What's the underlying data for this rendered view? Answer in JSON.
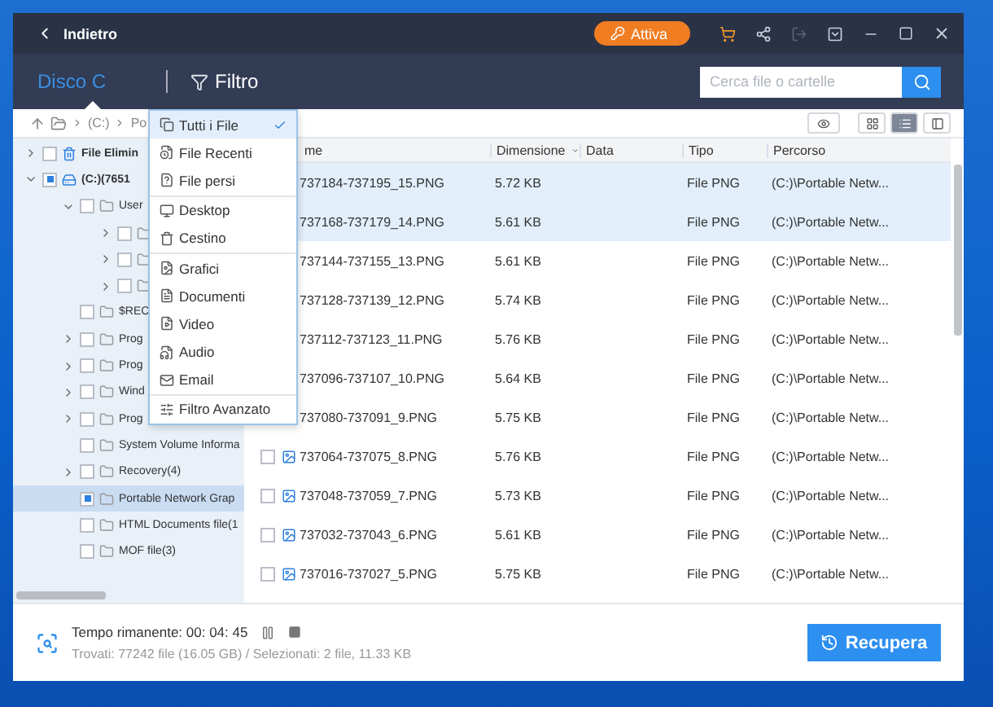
{
  "title_bar": {
    "back": "Indietro",
    "activate": "Attiva"
  },
  "header": {
    "tab": "Disco C",
    "filter": "Filtro",
    "search": {
      "placeholder": "Cerca file o cartelle"
    }
  },
  "breadcrumb": [
    "(C:)",
    "Po"
  ],
  "view_modes": [
    {
      "selected": false
    },
    {
      "selected": true
    },
    {
      "selected": false
    }
  ],
  "tree": [
    {
      "label": "File Elimin",
      "kind": "bin",
      "expandable": true,
      "expanded": false,
      "checked": false,
      "selected": false
    },
    {
      "label": "(C:)(7651",
      "kind": "drive",
      "expandable": true,
      "expanded": true,
      "checked": true,
      "selected": false,
      "children": [
        {
          "label": "User",
          "kind": "folder",
          "expandable": true,
          "expanded": true,
          "checked": false,
          "selected": false,
          "children": [
            {
              "kind": "folder",
              "expandable": true,
              "expanded": false,
              "checked": false,
              "selected": false
            },
            {
              "kind": "folder",
              "expandable": true,
              "expanded": false,
              "checked": false,
              "selected": false
            },
            {
              "kind": "folder",
              "expandable": true,
              "expanded": false,
              "checked": false,
              "selected": false
            }
          ]
        },
        {
          "label": "$REC",
          "kind": "folder",
          "expandable": false,
          "checked": false,
          "selected": false
        },
        {
          "label": "Prog",
          "kind": "folder",
          "expandable": true,
          "expanded": false,
          "checked": false,
          "selected": false
        },
        {
          "label": "Prog",
          "kind": "folder",
          "expandable": true,
          "expanded": false,
          "checked": false,
          "selected": false
        },
        {
          "label": "Wind",
          "kind": "folder",
          "expandable": true,
          "expanded": false,
          "checked": false,
          "selected": false
        },
        {
          "label": "Prog",
          "kind": "folder",
          "expandable": true,
          "expanded": false,
          "checked": false,
          "selected": false
        },
        {
          "label": "System Volume Informa",
          "kind": "folder",
          "expandable": false,
          "checked": false,
          "selected": false
        },
        {
          "label": "Recovery(4)",
          "kind": "folder",
          "expandable": true,
          "expanded": false,
          "checked": false,
          "selected": false
        },
        {
          "label": "Portable Network Grap",
          "kind": "folder",
          "expandable": false,
          "checked": true,
          "selected": true
        },
        {
          "label": "HTML Documents file(1",
          "kind": "folder",
          "expandable": false,
          "checked": false,
          "selected": false
        },
        {
          "label": "MOF file(3)",
          "kind": "folder",
          "expandable": false,
          "checked": false,
          "selected": false
        }
      ]
    }
  ],
  "table": {
    "columns": [
      "me",
      "Dimensione",
      "Data",
      "Tipo",
      "Percorso"
    ],
    "rows": [
      {
        "name": "737184-737195_15.PNG",
        "size": "5.72 KB",
        "type": "File PNG",
        "path": "(C:)\\Portable Netw...",
        "selected": true
      },
      {
        "name": "737168-737179_14.PNG",
        "size": "5.61 KB",
        "type": "File PNG",
        "path": "(C:)\\Portable Netw...",
        "selected": true
      },
      {
        "name": "737144-737155_13.PNG",
        "size": "5.61 KB",
        "type": "File PNG",
        "path": "(C:)\\Portable Netw...",
        "selected": false
      },
      {
        "name": "737128-737139_12.PNG",
        "size": "5.74 KB",
        "type": "File PNG",
        "path": "(C:)\\Portable Netw...",
        "selected": false
      },
      {
        "name": "737112-737123_11.PNG",
        "size": "5.76 KB",
        "type": "File PNG",
        "path": "(C:)\\Portable Netw...",
        "selected": false
      },
      {
        "name": "737096-737107_10.PNG",
        "size": "5.64 KB",
        "type": "File PNG",
        "path": "(C:)\\Portable Netw...",
        "selected": false
      },
      {
        "name": "737080-737091_9.PNG",
        "size": "5.75 KB",
        "type": "File PNG",
        "path": "(C:)\\Portable Netw...",
        "selected": false
      },
      {
        "name": "737064-737075_8.PNG",
        "size": "5.76 KB",
        "type": "File PNG",
        "path": "(C:)\\Portable Netw...",
        "selected": false,
        "checked": false
      },
      {
        "name": "737048-737059_7.PNG",
        "size": "5.73 KB",
        "type": "File PNG",
        "path": "(C:)\\Portable Netw...",
        "selected": false,
        "checked": false
      },
      {
        "name": "737032-737043_6.PNG",
        "size": "5.61 KB",
        "type": "File PNG",
        "path": "(C:)\\Portable Netw...",
        "selected": false,
        "checked": false
      },
      {
        "name": "737016-737027_5.PNG",
        "size": "5.75 KB",
        "type": "File PNG",
        "path": "(C:)\\Portable Netw...",
        "selected": false,
        "checked": false
      }
    ]
  },
  "filter_menu": [
    [
      {
        "label": "Tutti i File",
        "selected": true
      },
      {
        "label": "File Recenti",
        "selected": false
      },
      {
        "label": "File persi",
        "selected": false
      }
    ],
    [
      {
        "label": "Desktop",
        "selected": false
      },
      {
        "label": "Cestino",
        "selected": false
      }
    ],
    [
      {
        "label": "Grafici",
        "selected": false
      },
      {
        "label": "Documenti",
        "selected": false
      },
      {
        "label": "Video",
        "selected": false
      },
      {
        "label": "Audio",
        "selected": false
      },
      {
        "label": "Email",
        "selected": false
      }
    ],
    [
      {
        "label": "Filtro Avanzato",
        "selected": false
      }
    ]
  ],
  "status": {
    "remaining": "Tempo rimanente: 00: 04: 45",
    "summary": "Trovati: 77242 file (16.05 GB) / Selezionati: 2 file, 11.33 KB"
  },
  "recover_button": "Recupera"
}
